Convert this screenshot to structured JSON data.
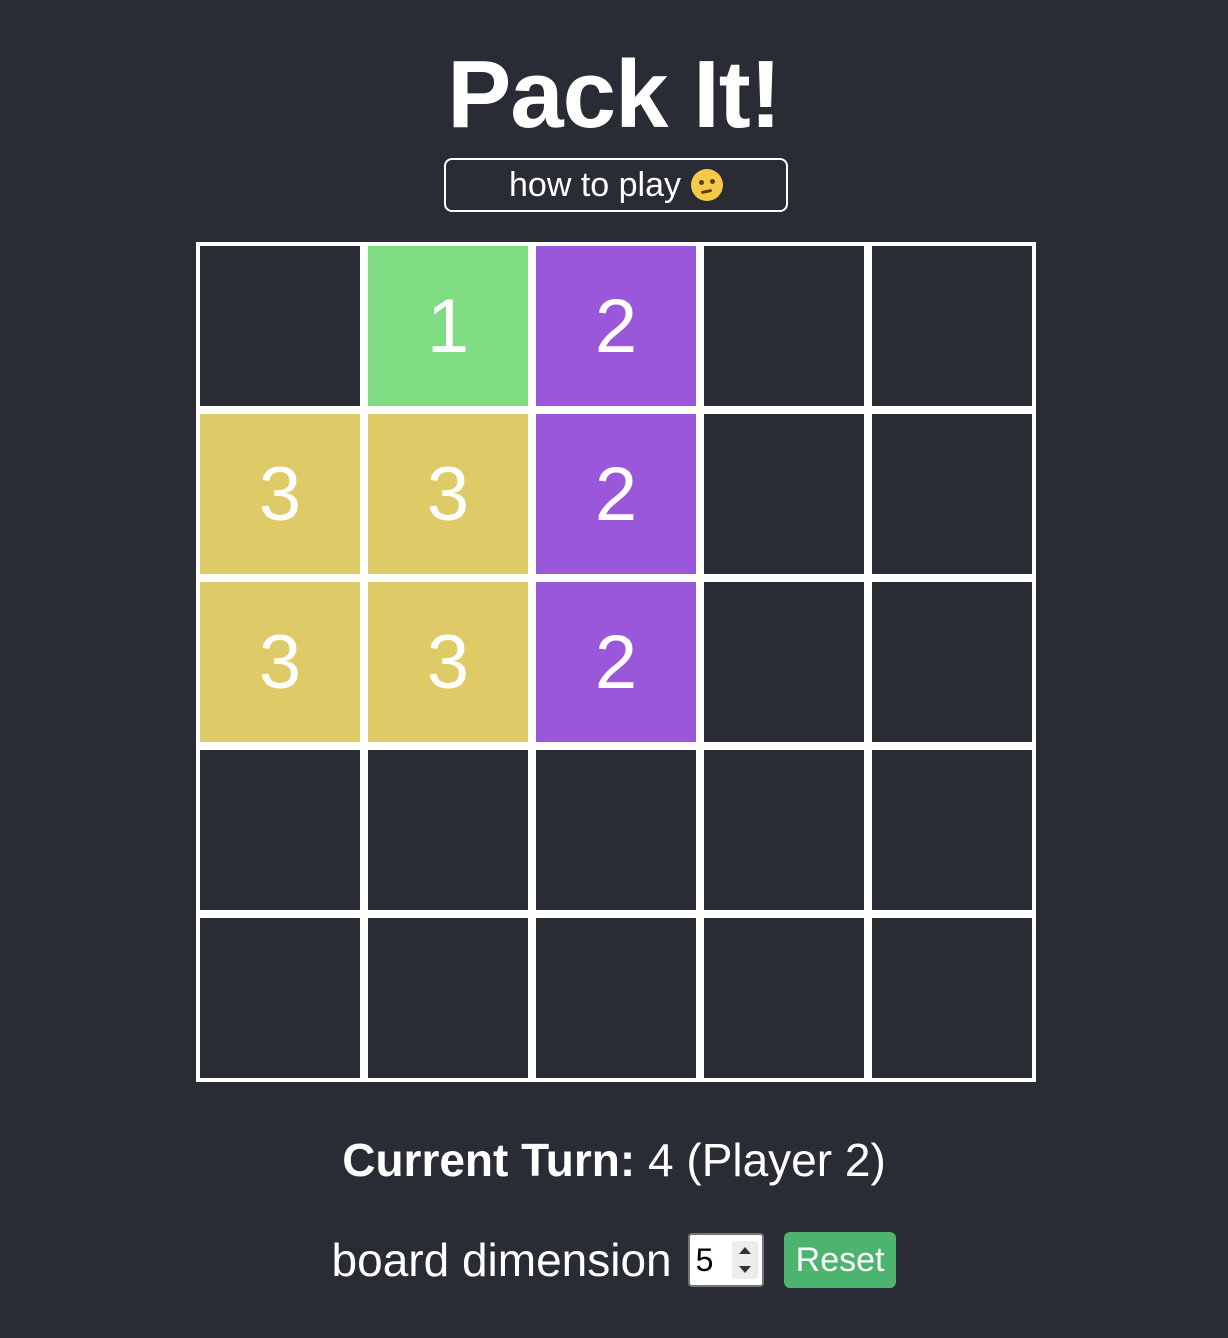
{
  "title": "Pack It!",
  "how_to_play": {
    "label": "how to play",
    "icon": "thinking-face-icon"
  },
  "colors": {
    "background": "#292c34",
    "grid_line": "#ffffff",
    "empty": "#292c34",
    "piece_1": "#7fdc83",
    "piece_2": "#9a57da",
    "piece_3": "#deca66",
    "reset": "#4cb46e"
  },
  "board": {
    "size": 5,
    "cells": [
      [
        null,
        1,
        2,
        null,
        null
      ],
      [
        3,
        3,
        2,
        null,
        null
      ],
      [
        3,
        3,
        2,
        null,
        null
      ],
      [
        null,
        null,
        null,
        null,
        null
      ],
      [
        null,
        null,
        null,
        null,
        null
      ]
    ]
  },
  "status": {
    "label": "Current Turn:",
    "value": "4 (Player 2)"
  },
  "controls": {
    "dimension_label": "board dimension",
    "dimension_value": "5",
    "reset_label": "Reset"
  }
}
